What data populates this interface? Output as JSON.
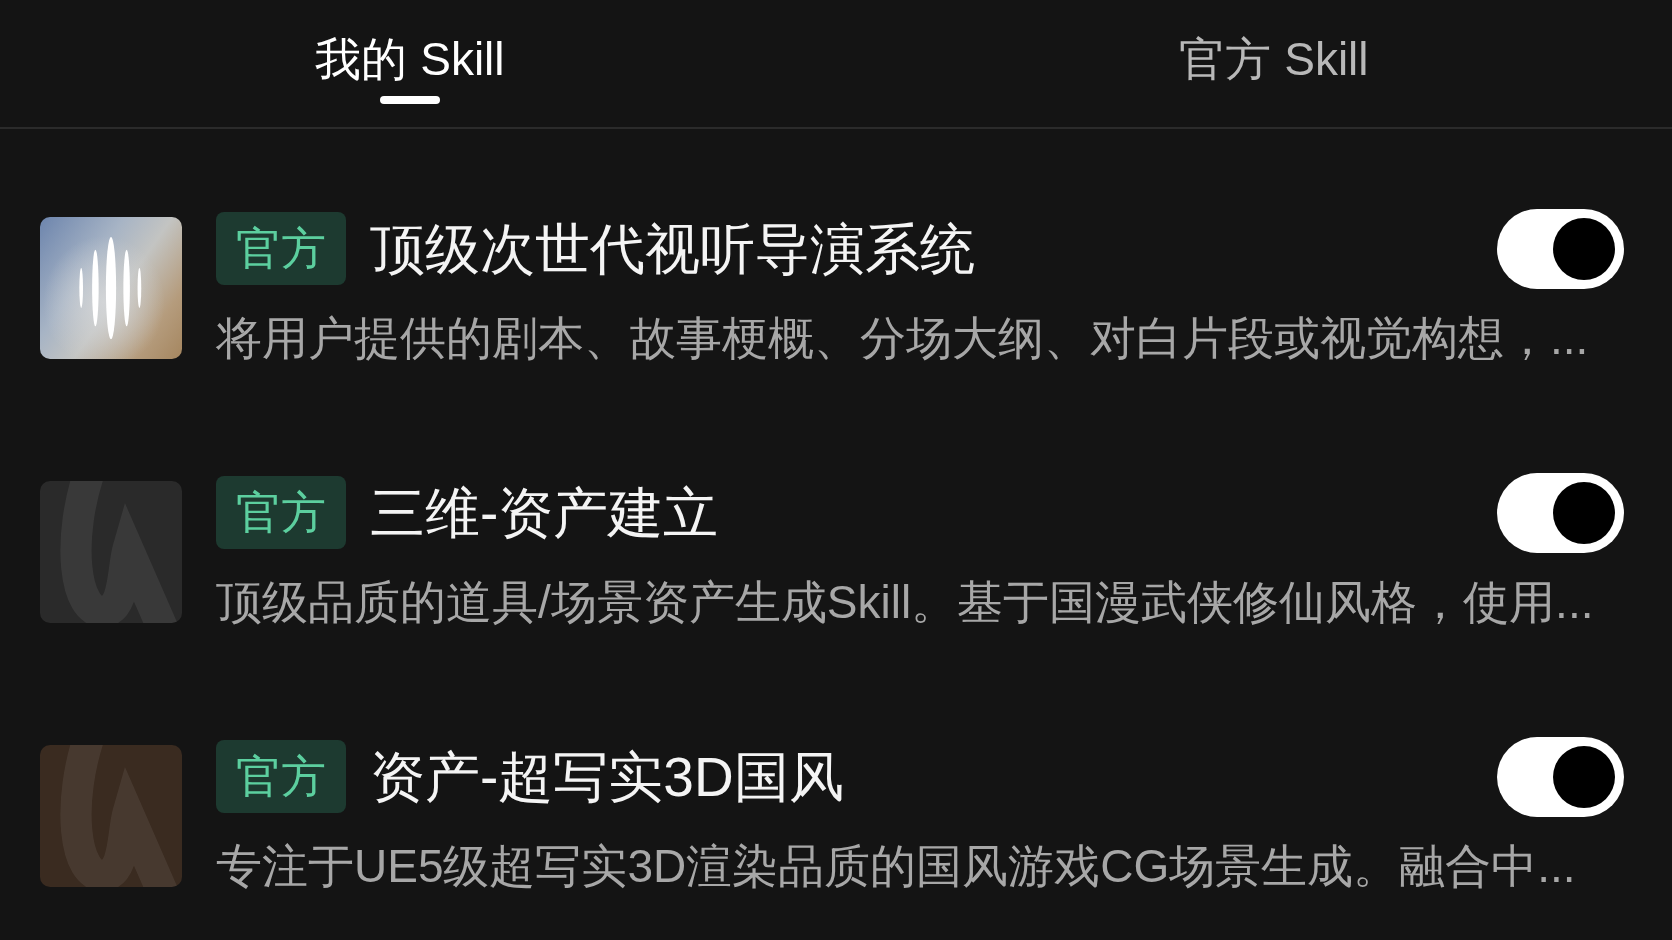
{
  "tabs": [
    {
      "label": "我的 Skill",
      "selected": true
    },
    {
      "label": "官方 Skill",
      "selected": false
    }
  ],
  "skills": [
    {
      "icon": {
        "kind": "waveform"
      },
      "badge": "官方",
      "title": "顶级次世代视听导演系统",
      "description": "将用户提供的剧本、故事梗概、分场大纲、对白片段或视觉构想，...",
      "on": true
    },
    {
      "icon": {
        "kind": "letter",
        "color": "#2a2a2a"
      },
      "badge": "官方",
      "title": "三维-资产建立",
      "description": "顶级品质的道具/场景资产生成Skill。基于国漫武侠修仙风格，使用...",
      "on": true
    },
    {
      "icon": {
        "kind": "letter",
        "color": "#3a2b20"
      },
      "badge": "官方",
      "title": "资产-超写实3D国风",
      "description": "专注于UE5级超写实3D渲染品质的国风游戏CG场景生成。融合中...",
      "on": true
    }
  ]
}
